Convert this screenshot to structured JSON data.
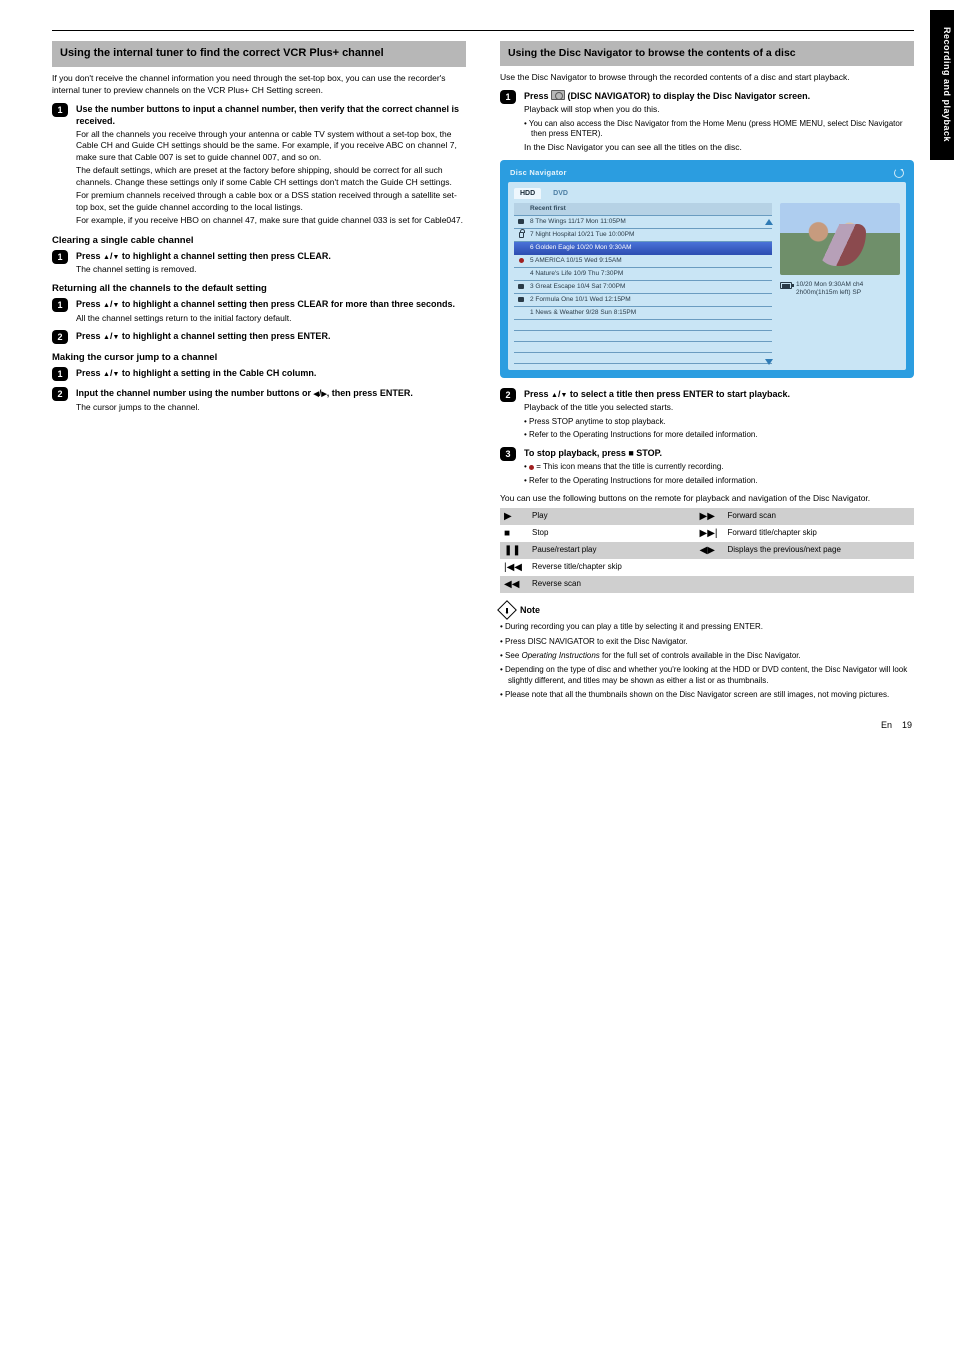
{
  "header": {
    "rule": true
  },
  "side_tab": "Recording and playback",
  "page": {
    "number": "19",
    "lang": "En"
  },
  "left": {
    "sect1_title": "Using the internal tuner to find the correct VCR Plus+ channel",
    "sect1_desc": "If you don't receive the channel information you need through the set-top box, you can use the recorder's internal tuner to preview channels on the VCR Plus+ CH Setting screen.",
    "step1": "Use the number buttons to input a channel number, then verify that the correct channel is received.",
    "step1_lines": [
      "For all the channels you receive through your antenna or cable TV system without a set-top box, the Cable CH and Guide CH settings should be the same. For example, if you receive ABC on channel 7, make sure that Cable 007 is set to guide channel 007, and so on.",
      "The default settings, which are preset at the factory before shipping, should be correct for all such channels. Change these settings only if some Cable CH settings don't match the Guide CH settings.",
      "For premium channels received through a cable box or a DSS station received through a satellite set-top box, set the guide channel according to the local listings.",
      "For example, if you receive HBO on channel 47, make sure that guide channel 033 is set for Cable047."
    ],
    "sub_clear": "Clearing a single cable channel",
    "sub_clear_step": "Press ▲/▼ to highlight a channel setting then press CLEAR.",
    "sub_clear_note": "The channel setting is removed.",
    "sub_return": "Returning all the channels to the default setting",
    "sub_return_step1": "Press ▲/▼ to highlight a channel setting then press CLEAR for more than three seconds.",
    "sub_return_note": "All the channel settings return to the initial factory default.",
    "sub_return_step2": "Press ▲/▼ to highlight a channel setting then press ENTER.",
    "sub_cursor": "Making the cursor jump to a channel",
    "sub_cursor_step1": "Press ▲/▼ to highlight a setting in the Cable CH column.",
    "sub_cursor_step2": "Input the channel number using the number buttons or ◀/▶, then press ENTER.",
    "sub_cursor_note": "The cursor jumps to the channel."
  },
  "right": {
    "sect_title": "Using the Disc Navigator to browse the contents of a disc",
    "intro": "Use the Disc Navigator to browse through the recorded contents of a disc and start playback.",
    "step1": "Press      (DISC NAVIGATOR) to display the Disc Navigator screen.",
    "step1_sub": "Playback will stop when you do this.",
    "step1_note1": "• You can also access the Disc Navigator from the Home Menu (press HOME MENU, select Disc Navigator then press ENTER).",
    "step1_note2": "In the Disc Navigator you can see all the titles on the disc.",
    "dn": {
      "header": "Disc Navigator",
      "tabs": {
        "active": "HDD",
        "other": "DVD"
      },
      "list_header": "Recent first",
      "rows": [
        {
          "icon": "sq",
          "t": "8 The Wings           11/17 Mon 11:05PM"
        },
        {
          "icon": "lock",
          "t": "7 Night Hospital     10/21 Tue 10:00PM"
        },
        {
          "icon": "sel",
          "t": "6 Golden Eagle      10/20 Mon  9:30AM"
        },
        {
          "icon": "dot",
          "t": "5 AMERICA            10/15 Wed  9:15AM"
        },
        {
          "icon": "",
          "t": "4 Nature's Life       10/9 Thu  7:30PM"
        },
        {
          "icon": "sq",
          "t": "3 Great Escape        10/4 Sat  7:00PM"
        },
        {
          "icon": "sq",
          "t": "2 Formula One         10/1 Wed 12:15PM"
        },
        {
          "icon": "",
          "t": "1 News & Weather    9/28 Sun  8:15PM"
        }
      ],
      "meta": "10/20 Mon  9:30AM ch4\n2h00m(1h15m left) SP"
    },
    "step2": "Press ▲/▼ to select a title then press ENTER to start playback.",
    "step2_sub": "Playback of the title you selected starts.",
    "step2_note1": "• Press STOP anytime to stop playback.",
    "step2_note2": "• Refer to the Operating Instructions for more detailed information.",
    "step3": "To stop playback, press ■ STOP.",
    "step3_note1": "•    = This icon means that the title is currently recording.",
    "step3_note2": "• Refer to the Operating Instructions for more detailed information.",
    "keys_intro": "You can use the following buttons on the remote for playback and navigation of the Disc Navigator.",
    "keys": {
      "r1a_lbl": "Play",
      "r1b_lbl": "Forward scan",
      "r2a_lbl": "Stop",
      "r2b_lbl": "Forward title/chapter skip",
      "r3a_lbl": "Pause/restart play",
      "r3b_lbl": "Displays the previous/next page",
      "r4a_lbl": "Reverse title/chapter skip",
      "r5a_lbl": "Reverse scan"
    },
    "notes_heading": "Note",
    "notes": [
      "During recording you can play a title by selecting it and pressing ENTER.",
      "Press DISC NAVIGATOR to exit the Disc Navigator.",
      "See Operating Instructions for the full set of controls available in the Disc Navigator.",
      "Depending on the type of disc and whether you're looking at the HDD or DVD content, the Disc Navigator will look slightly different, and titles may be shown as either a list or as thumbnails.",
      "Please note that all the thumbnails shown on the Disc Navigator screen are still images, not moving pictures."
    ]
  }
}
